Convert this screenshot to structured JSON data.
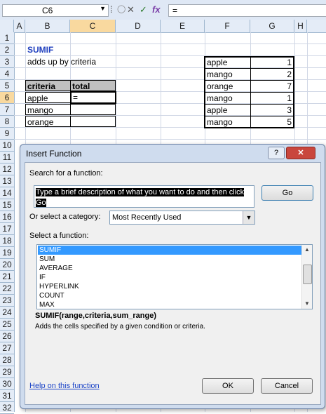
{
  "formula_bar": {
    "name_box": "C6",
    "content": "="
  },
  "columns": [
    "A",
    "B",
    "C",
    "D",
    "E",
    "F",
    "G",
    "H"
  ],
  "rows": [
    "1",
    "2",
    "3",
    "4",
    "5",
    "6",
    "7",
    "8",
    "9",
    "10",
    "11",
    "12",
    "13",
    "14",
    "15",
    "16",
    "17",
    "18",
    "19",
    "20",
    "21",
    "22",
    "23",
    "24",
    "25",
    "26",
    "27",
    "28",
    "29",
    "30",
    "31",
    "32"
  ],
  "sheet": {
    "title": "SUMIF",
    "subtitle": "adds up by criteria",
    "criteria_header": "criteria",
    "total_header": "total",
    "criteria": [
      "apple",
      "mango",
      "orange"
    ],
    "active_cell_value": "=",
    "data_items": [
      {
        "name": "apple",
        "value": "1"
      },
      {
        "name": "mango",
        "value": "2"
      },
      {
        "name": "orange",
        "value": "7"
      },
      {
        "name": "mango",
        "value": "1"
      },
      {
        "name": "apple",
        "value": "3"
      },
      {
        "name": "mango",
        "value": "5"
      }
    ]
  },
  "dialog": {
    "title": "Insert Function",
    "help_button": "?",
    "search_label": "Search for a function:",
    "search_value": "Type a brief description of what you want to do and then click Go",
    "go_label": "Go",
    "category_label": "Or select a category:",
    "category_value": "Most Recently Used",
    "function_label": "Select a function:",
    "functions": [
      "SUMIF",
      "SUM",
      "AVERAGE",
      "IF",
      "HYPERLINK",
      "COUNT",
      "MAX"
    ],
    "selected_function": "SUMIF",
    "signature": "SUMIF(range,criteria,sum_range)",
    "description": "Adds the cells specified by a given condition or criteria.",
    "help_link": "Help on this function",
    "ok_label": "OK",
    "cancel_label": "Cancel"
  },
  "colors": {
    "selected_header": "#f9d99f",
    "selected_item": "#3399ff",
    "title_text": "#1f3fbf"
  }
}
